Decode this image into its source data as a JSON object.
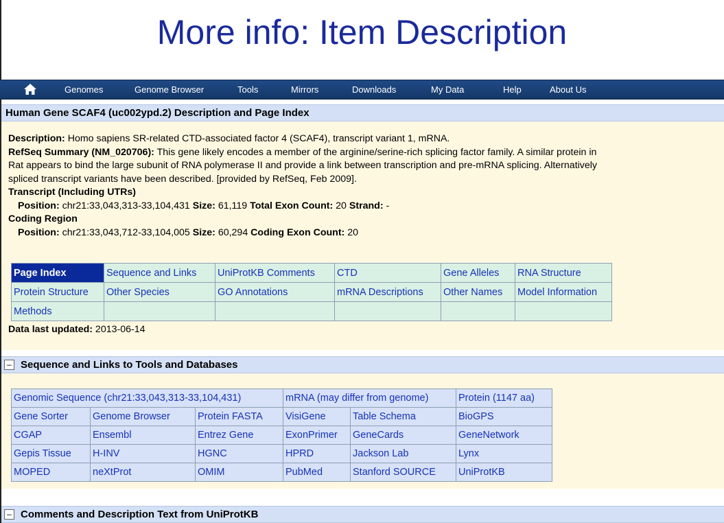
{
  "slide_title": "More info: Item Description",
  "navbar": {
    "home_icon": "home-icon",
    "items": [
      "Genomes",
      "Genome Browser",
      "Tools",
      "Mirrors",
      "Downloads",
      "My Data",
      "Help",
      "About Us"
    ]
  },
  "gene_header": "Human Gene SCAF4 (uc002ypd.2) Description and Page Index",
  "description": {
    "desc_label": "Description:",
    "desc_text": " Homo sapiens SR-related CTD-associated factor 4 (SCAF4), transcript variant 1, mRNA.",
    "refseq_label": "RefSeq Summary (NM_020706):",
    "refseq_line1": " This gene likely encodes a member of the arginine/serine-rich splicing factor family. A similar protein in",
    "refseq_line2": "Rat appears to bind the large subunit of RNA polymerase II and provide a link between transcription and pre-mRNA splicing. Alternatively",
    "refseq_line3": "spliced transcript variants have been described. [provided by RefSeq, Feb 2009].",
    "transcript_label": "Transcript (Including UTRs)",
    "transcript_position_label": "Position:",
    "transcript_position": " chr21:33,043,313-33,104,431 ",
    "transcript_size_label": "Size:",
    "transcript_size": " 61,119 ",
    "exon_count_label": "Total Exon Count:",
    "exon_count": " 20 ",
    "strand_label": "Strand:",
    "strand": " -",
    "coding_label": "Coding Region",
    "coding_position_label": "Position:",
    "coding_position": " chr21:33,043,712-33,104,005 ",
    "coding_size_label": "Size:",
    "coding_size": " 60,294 ",
    "coding_exon_label": "Coding Exon Count:",
    "coding_exon_count": " 20"
  },
  "page_index": {
    "rows": [
      [
        "Page Index",
        "Sequence and Links",
        "UniProtKB Comments",
        "CTD",
        "Gene Alleles",
        "RNA Structure"
      ],
      [
        "Protein Structure",
        "Other Species",
        "GO Annotations",
        "mRNA Descriptions",
        "Other Names",
        "Model Information"
      ],
      [
        "Methods",
        "",
        "",
        "",
        "",
        ""
      ]
    ]
  },
  "updated": {
    "label": "Data last updated:",
    "value": " 2013-06-14"
  },
  "sections": {
    "seq_links_title": "Sequence and Links to Tools and Databases",
    "uniprot_title": "Comments and Description Text from UniProtKB",
    "toggle_symbol": "–"
  },
  "links_table": {
    "row1": [
      "Genomic Sequence (chr21:33,043,313-33,104,431)",
      "mRNA (may differ from genome)",
      "Protein (1147 aa)"
    ],
    "rows": [
      [
        "Gene Sorter",
        "Genome Browser",
        "Protein FASTA",
        "VisiGene",
        "Table Schema",
        "BioGPS"
      ],
      [
        "CGAP",
        "Ensembl",
        "Entrez Gene",
        "ExonPrimer",
        "GeneCards",
        "GeneNetwork"
      ],
      [
        "Gepis Tissue",
        "H-INV",
        "HGNC",
        "HPRD",
        "Jackson Lab",
        "Lynx"
      ],
      [
        "MOPED",
        "neXtProt",
        "OMIM",
        "PubMed",
        "Stanford SOURCE",
        "UniProtKB"
      ]
    ]
  },
  "colors": {
    "title": "#1a2a9c",
    "navbar": "#1f4a86",
    "link": "#1733b8",
    "active_tab": "#0a2a9c",
    "panel": "#fff8e1",
    "index_cell": "#d9f0e4",
    "links_cell": "#d7e1f7"
  }
}
